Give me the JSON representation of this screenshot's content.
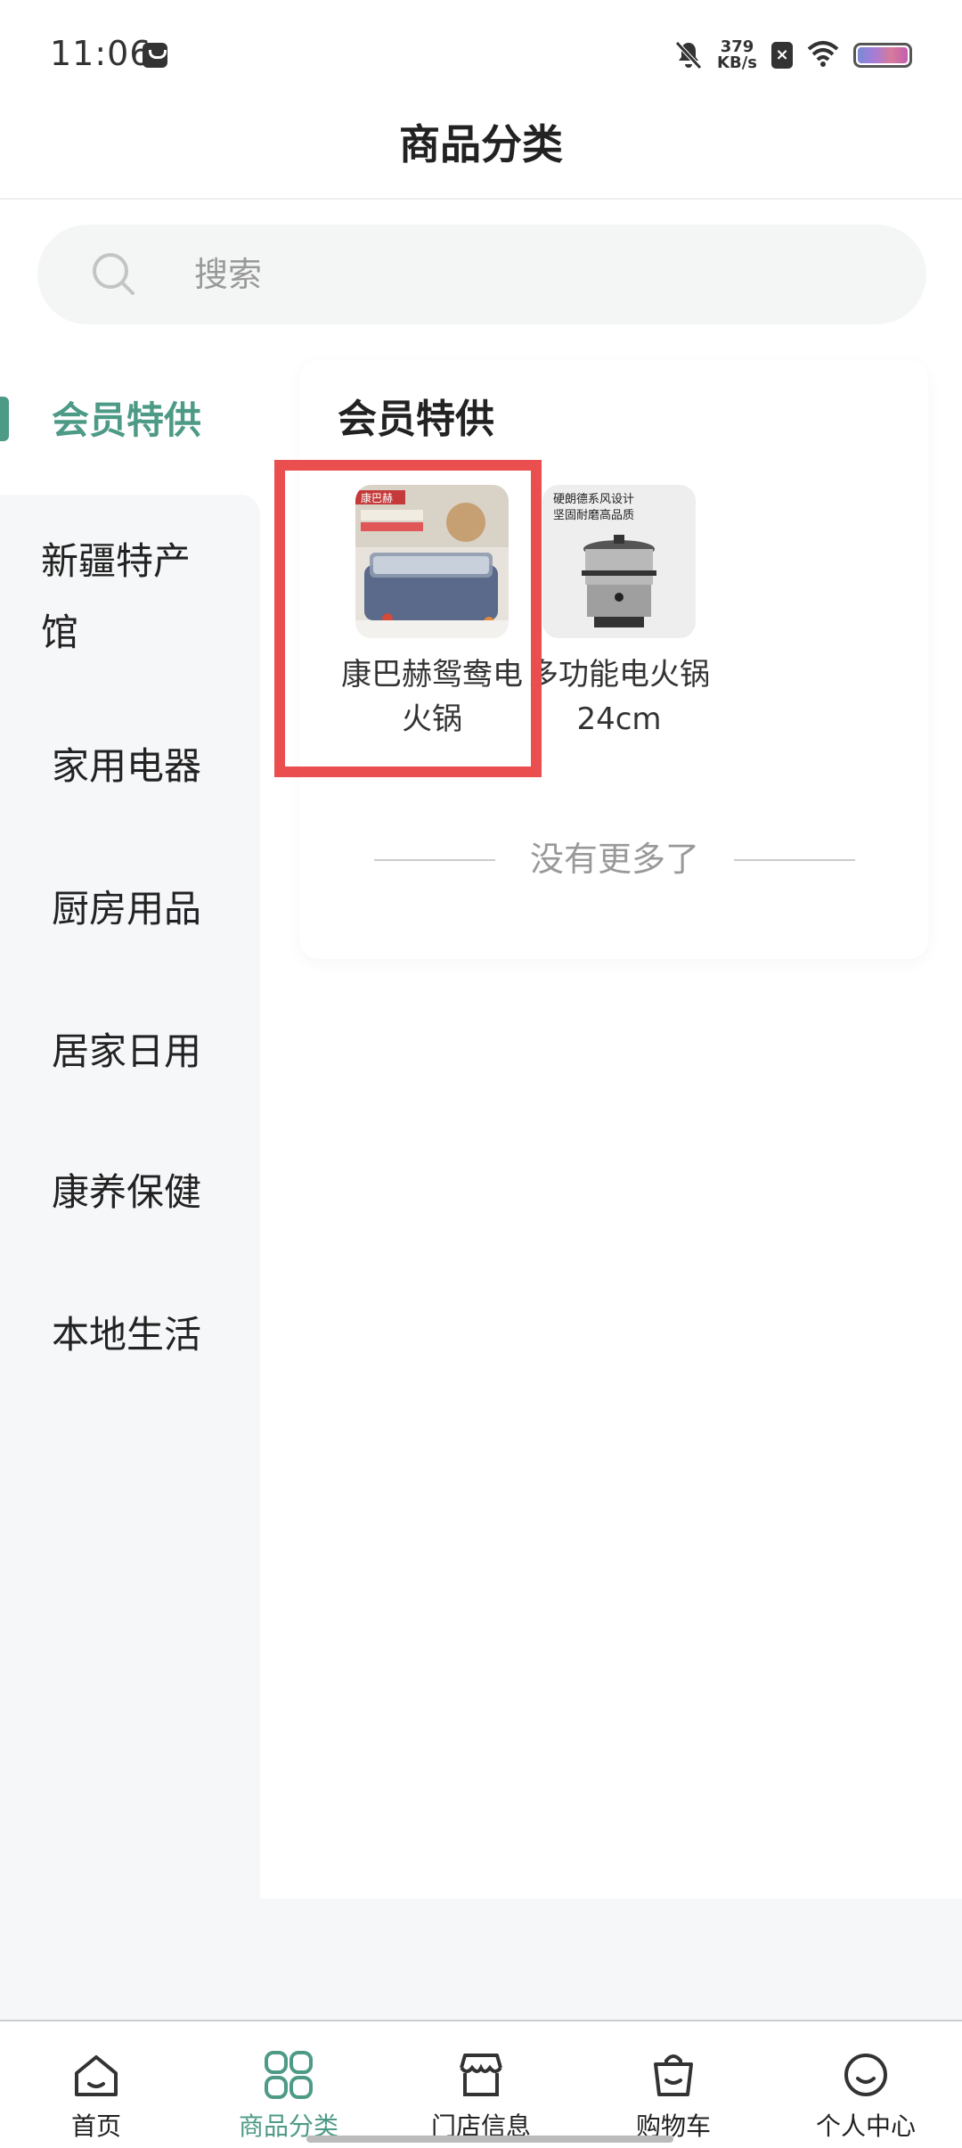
{
  "status_bar": {
    "time": "11:06",
    "net_speed_value": "379",
    "net_speed_unit": "KB/s"
  },
  "header": {
    "title": "商品分类"
  },
  "search": {
    "placeholder": "搜索"
  },
  "sidebar": {
    "items": [
      {
        "label": "会员特供",
        "active": true
      },
      {
        "label": "新疆特产馆"
      },
      {
        "label": "家用电器"
      },
      {
        "label": "厨房用品"
      },
      {
        "label": "居家日用"
      },
      {
        "label": "康养保健"
      },
      {
        "label": "本地生活"
      }
    ]
  },
  "content": {
    "section_title": "会员特供",
    "products": [
      {
        "name": "康巴赫鸳鸯电火锅",
        "image_badge": "康巴赫"
      },
      {
        "name": "多功能电火锅24cm",
        "image_text": "硬朗德系风设计 坚固耐磨高品质"
      }
    ],
    "no_more": "没有更多了"
  },
  "tabbar": {
    "items": [
      {
        "label": "首页",
        "icon": "home-icon"
      },
      {
        "label": "商品分类",
        "icon": "category-icon",
        "active": true
      },
      {
        "label": "门店信息",
        "icon": "store-icon"
      },
      {
        "label": "购物车",
        "icon": "cart-bag-icon"
      },
      {
        "label": "个人中心",
        "icon": "profile-smile-icon"
      }
    ]
  },
  "colors": {
    "accent": "#4d9a86",
    "highlight": "#ea4e4e",
    "sidebar_bg": "#f6f7f9"
  }
}
